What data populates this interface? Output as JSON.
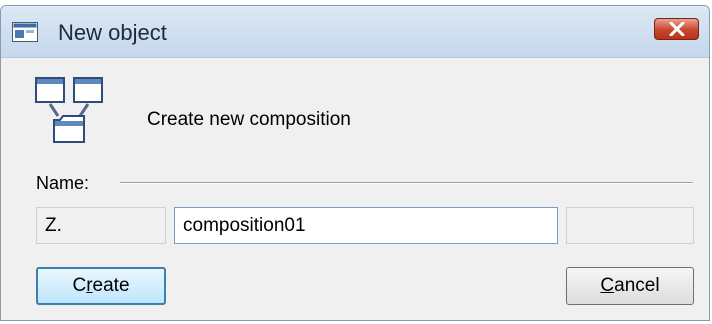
{
  "window": {
    "title": "New object"
  },
  "content": {
    "heading": "Create new composition"
  },
  "name_section": {
    "label": "Name:"
  },
  "fields": {
    "prefix": "Z.",
    "name_value": "composition01",
    "suffix": ""
  },
  "buttons": {
    "create": {
      "pre": "C",
      "mnemonic": "r",
      "post": "eate"
    },
    "cancel": {
      "pre": "",
      "mnemonic": "C",
      "post": "ancel"
    }
  },
  "icons": {
    "app": "window-icon",
    "close": "close-icon",
    "composition": "composition-icon"
  }
}
